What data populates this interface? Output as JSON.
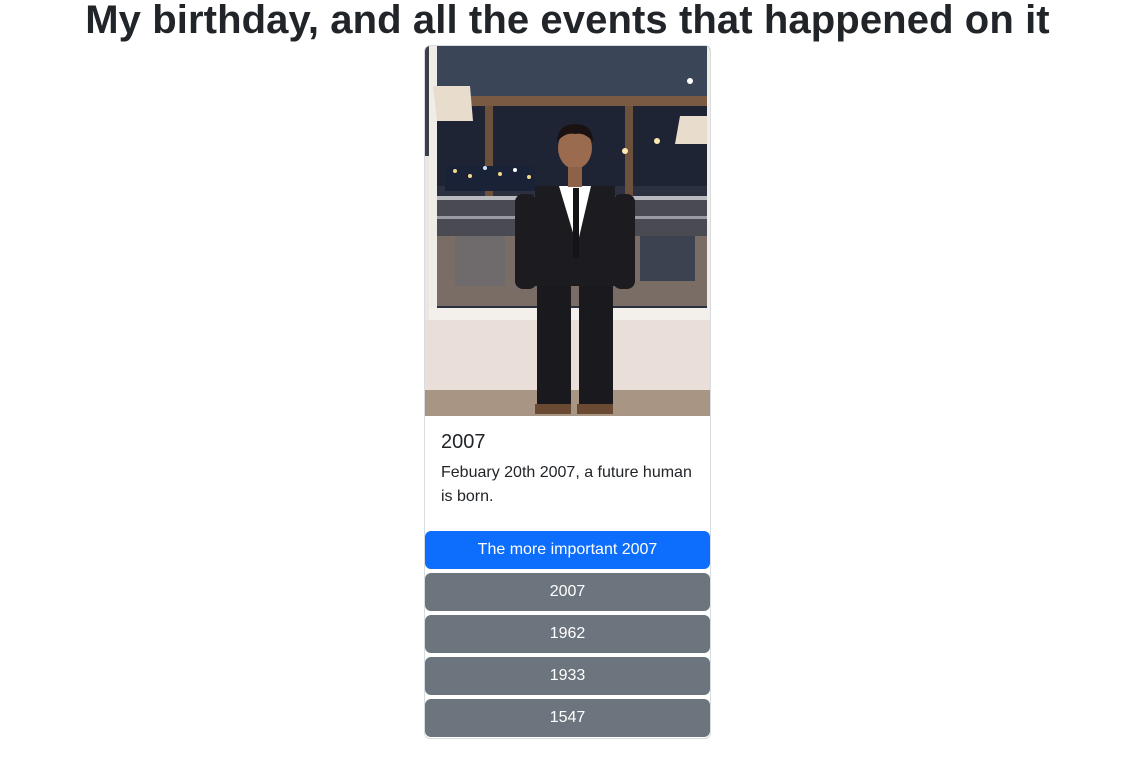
{
  "page": {
    "title": "My birthday, and all the events that happened on it"
  },
  "card": {
    "title": "2007",
    "text": "Febuary 20th 2007, a future human is born.",
    "primary_button": "The more important 2007",
    "year_buttons": [
      "2007",
      "1962",
      "1933",
      "1547"
    ]
  },
  "colors": {
    "primary": "#0d6efd",
    "secondary": "#6c757d",
    "text": "#212529"
  }
}
